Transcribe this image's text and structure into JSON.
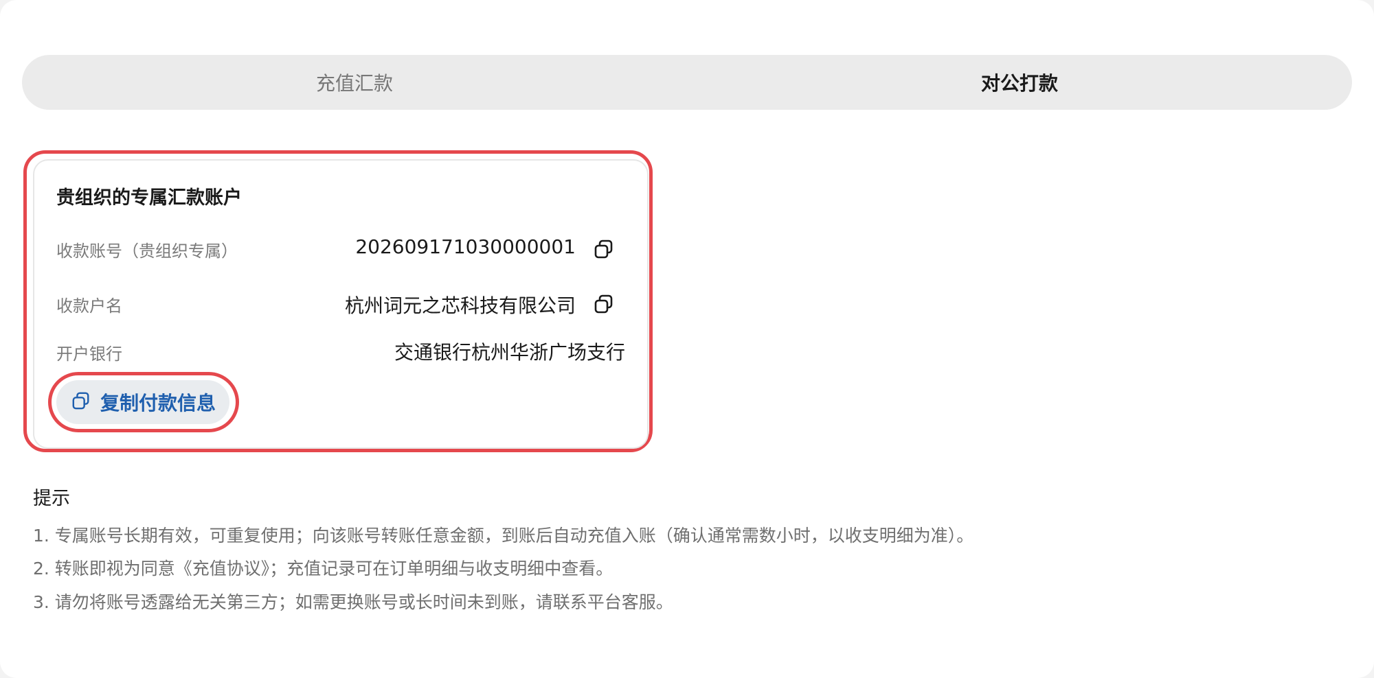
{
  "tabs": [
    {
      "label": "充值汇款",
      "active": false
    },
    {
      "label": "对公打款",
      "active": true
    }
  ],
  "account_card": {
    "title": "贵组织的专属汇款账户",
    "account_number_label": "收款账号（贵组织专属）",
    "account_number": "202609171030000001",
    "account_name_label": "收款户名",
    "account_name": "杭州词元之芯科技有限公司",
    "bank_label": "开户银行",
    "bank": "交通银行杭州华浙广场支行",
    "copy_button_label": "复制付款信息",
    "copy_icon": "copy-icon"
  },
  "tips": {
    "title": "提示",
    "items": [
      "1. 专属账号长期有效，可重复使用；向该账号转账任意金额，到账后自动充值入账（确认通常需数小时，以收支明细为准）。",
      "2. 转账即视为同意《充值协议》；充值记录可在订单明细与收支明细中查看。",
      "3. 请勿将账号透露给无关第三方；如需更换账号或长时间未到账，请联系平台客服。"
    ]
  },
  "colors": {
    "highlight": "#e5484d",
    "button_text": "#1f5fae",
    "tab_bg": "#ebebeb"
  }
}
